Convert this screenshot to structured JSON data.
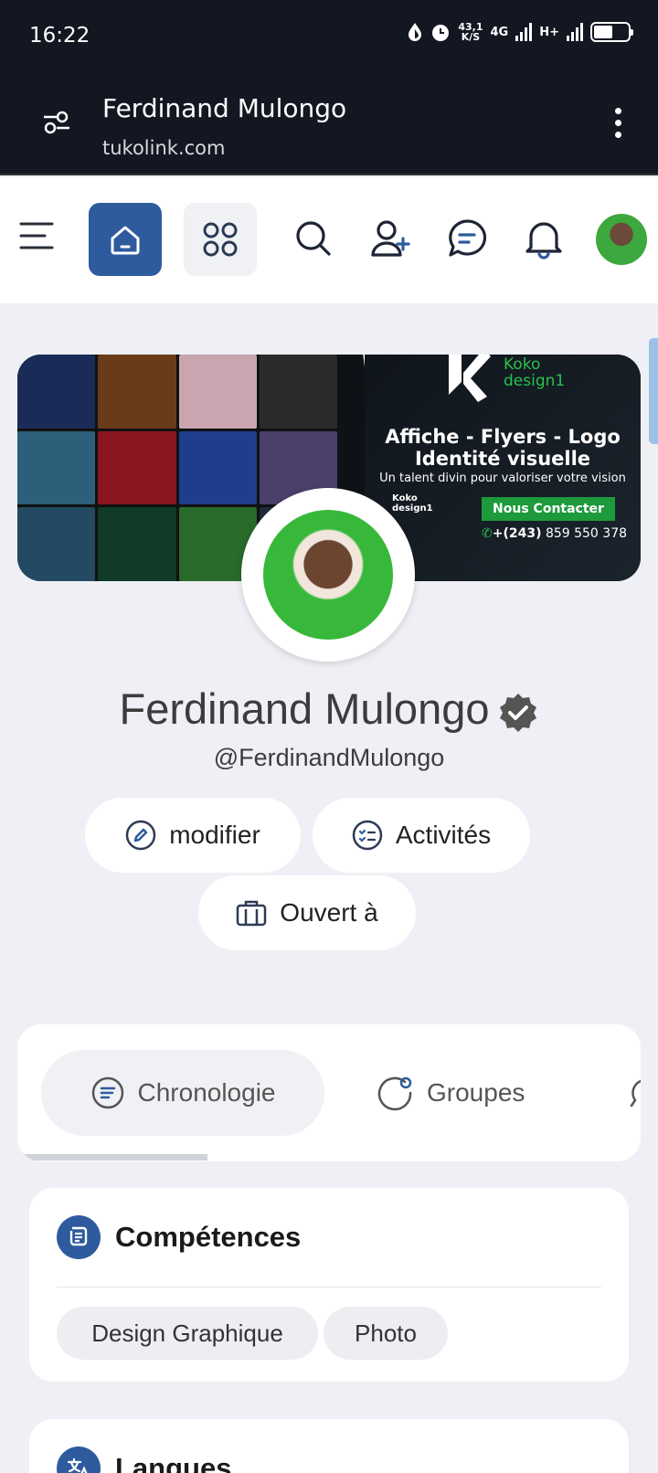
{
  "status_bar": {
    "time": "16:22",
    "speed_value": "43,1",
    "speed_unit": "K/S",
    "network_1": "4G",
    "network_2": "H+"
  },
  "browser": {
    "title": "Ferdinand Mulongo",
    "url": "tukolink.com"
  },
  "nav": {
    "icons": [
      "menu-icon",
      "home-icon",
      "apps-icon",
      "search-icon",
      "add-user-icon",
      "messages-icon",
      "notifications-icon"
    ],
    "accent": "#2e5b9e"
  },
  "cover": {
    "brand_line1": "Koko",
    "brand_line2": "design1",
    "headline_1": "Affiche - Flyers - Logo",
    "headline_2": "Identité visuelle",
    "tagline": "Un talent divin pour valoriser votre vision",
    "cta": "Nous Contacter",
    "phone_code": "+(243)",
    "phone_number": " 859 550 378"
  },
  "profile": {
    "name": "Ferdinand Mulongo",
    "handle": "@FerdinandMulongo",
    "actions": {
      "edit": "modifier",
      "activities": "Activités",
      "open_to": "Ouvert à"
    }
  },
  "tabs": {
    "items": [
      "Chronologie",
      "Groupes"
    ]
  },
  "skills": {
    "title": "Compétences",
    "chips": [
      "Design Graphique",
      "Photo"
    ]
  },
  "languages": {
    "title": "Langues"
  }
}
